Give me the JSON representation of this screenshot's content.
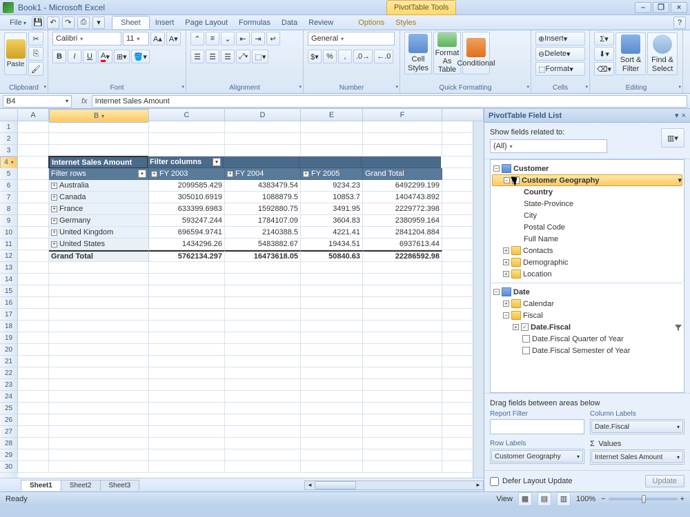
{
  "title": "Book1 - Microsoft Excel",
  "context_tab": "PivotTable Tools",
  "menu": {
    "file": "File",
    "qat": [
      "save",
      "undo",
      "redo",
      "print"
    ],
    "tabs": [
      "Sheet",
      "Insert",
      "Page Layout",
      "Formulas",
      "Data",
      "Review"
    ],
    "context_tabs": [
      "Options",
      "Styles"
    ],
    "active": "Sheet"
  },
  "ribbon": {
    "groups": [
      "Clipboard",
      "Font",
      "Alignment",
      "Number",
      "Quick Formatting",
      "Cells",
      "Editing"
    ],
    "font": {
      "name": "Calibri",
      "size": "11"
    },
    "number_format": "General",
    "qf": {
      "cell": "Cell Styles",
      "table": "Format As Table",
      "cond": "Conditional"
    },
    "cells": {
      "insert": "Insert",
      "delete": "Delete",
      "format": "Format"
    },
    "editing": {
      "sort": "Sort & Filter",
      "find": "Find & Select"
    }
  },
  "namebox": "B4",
  "formula": "Internet Sales Amount",
  "cols": [
    {
      "l": "A",
      "w": 45
    },
    {
      "l": "B",
      "w": 145
    },
    {
      "l": "C",
      "w": 110
    },
    {
      "l": "D",
      "w": 110
    },
    {
      "l": "E",
      "w": 90
    },
    {
      "l": "F",
      "w": 115
    }
  ],
  "pivot": {
    "measure": "Internet Sales Amount",
    "col_caption": "Filter columns",
    "row_caption": "Filter rows",
    "col_headers": [
      "FY 2003",
      "FY 2004",
      "FY 2005",
      "Grand Total"
    ],
    "rows": [
      {
        "label": "Australia",
        "v": [
          "2099585.429",
          "4383479.54",
          "9234.23",
          "6492299.199"
        ]
      },
      {
        "label": "Canada",
        "v": [
          "305010.6919",
          "1088879.5",
          "10853.7",
          "1404743.892"
        ]
      },
      {
        "label": "France",
        "v": [
          "633399.6983",
          "1592880.75",
          "3491.95",
          "2229772.398"
        ]
      },
      {
        "label": "Germany",
        "v": [
          "593247.244",
          "1784107.09",
          "3604.83",
          "2380959.164"
        ]
      },
      {
        "label": "United Kingdom",
        "v": [
          "696594.9741",
          "2140388.5",
          "4221.41",
          "2841204.884"
        ]
      },
      {
        "label": "United States",
        "v": [
          "1434296.26",
          "5483882.67",
          "19434.51",
          "6937613.44"
        ]
      }
    ],
    "grand": {
      "label": "Grand Total",
      "v": [
        "5762134.297",
        "16473618.05",
        "50840.63",
        "22286592.98"
      ]
    }
  },
  "pane": {
    "title": "PivotTable Field List",
    "show_label": "Show fields related to:",
    "show_value": "(All)",
    "tree": {
      "customer": "Customer",
      "custgeo": "Customer Geography",
      "geo": [
        "Country",
        "State-Province",
        "City",
        "Postal Code",
        "Full Name"
      ],
      "contacts": "Contacts",
      "demo": "Demographic",
      "loc": "Location",
      "date": "Date",
      "calendar": "Calendar",
      "fiscal": "Fiscal",
      "datefiscal": "Date.Fiscal",
      "fq": "Date.Fiscal Quarter of Year",
      "fs": "Date.Fiscal Semester of Year"
    },
    "areas": {
      "hint": "Drag fields between areas below",
      "rf": "Report Filter",
      "cl": "Column Labels",
      "rl": "Row Labels",
      "vl": "Values",
      "cl_v": "Date.Fiscal",
      "rl_v": "Customer Geography",
      "vl_v": "Internet Sales Amount",
      "sigma": "Σ"
    },
    "defer": "Defer Layout Update",
    "update": "Update"
  },
  "sheets": [
    "Sheet1",
    "Sheet2",
    "Sheet3"
  ],
  "status": {
    "ready": "Ready",
    "view": "View",
    "zoom": "100%"
  }
}
